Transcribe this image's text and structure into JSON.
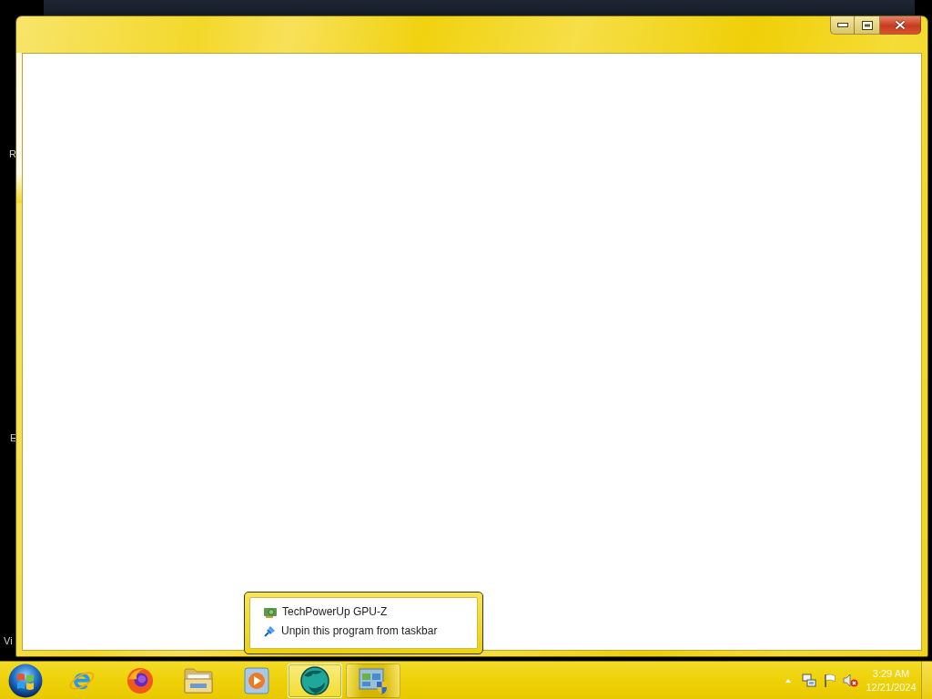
{
  "desktop": {
    "icon_labels": [
      "R",
      "E",
      "Vi"
    ]
  },
  "window": {
    "controls": [
      {
        "kind": "minimize"
      },
      {
        "kind": "maximize"
      },
      {
        "kind": "close"
      }
    ]
  },
  "jump_list": {
    "items": [
      {
        "kind": "app",
        "label": "TechPowerUp GPU-Z"
      },
      {
        "kind": "unpin",
        "label": "Unpin this program from taskbar"
      }
    ]
  },
  "taskbar": {
    "apps": [
      {
        "kind": "browser_e",
        "running": false,
        "selected": false
      },
      {
        "kind": "fox_globe",
        "running": false,
        "selected": false
      },
      {
        "kind": "folder",
        "running": false,
        "selected": false
      },
      {
        "kind": "media_player",
        "running": false,
        "selected": false
      },
      {
        "kind": "gpu_globe",
        "running": true,
        "selected": true
      },
      {
        "kind": "window_shield",
        "running": true,
        "selected": false
      }
    ],
    "tray_icons": [
      {
        "kind": "overflow"
      },
      {
        "kind": "network"
      },
      {
        "kind": "flag"
      },
      {
        "kind": "volume",
        "muted": true
      }
    ],
    "clock": {
      "time": "3:29 AM",
      "date": "12/21/2024"
    }
  }
}
